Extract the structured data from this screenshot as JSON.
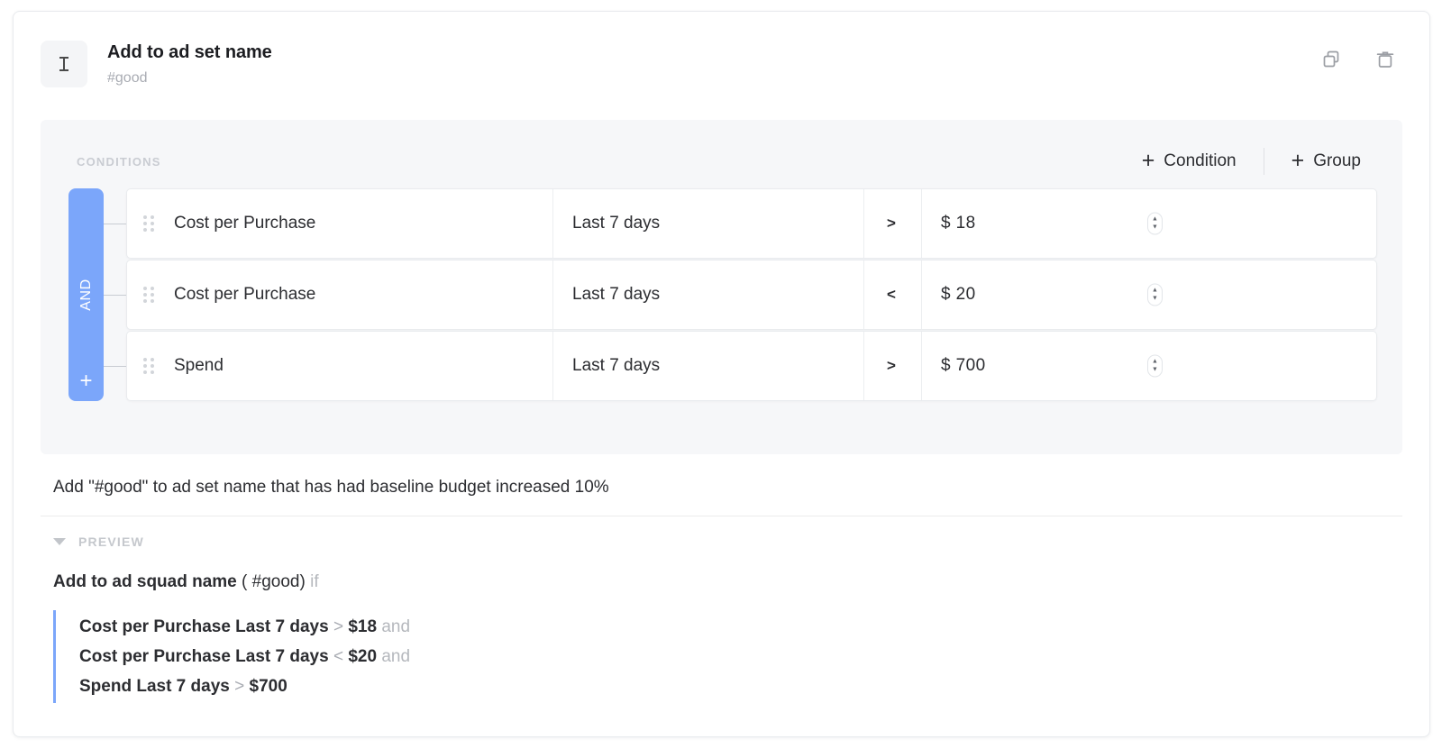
{
  "header": {
    "icon": "text-cursor-icon",
    "title": "Add to ad set name",
    "subtitle": "#good",
    "duplicate_icon": "copy-icon",
    "delete_icon": "trash-icon"
  },
  "conditions": {
    "label": "CONDITIONS",
    "add_condition_label": "Condition",
    "add_group_label": "Group",
    "plus_glyph": "+",
    "group_operator": "AND",
    "group_add_glyph": "+",
    "accent_color": "#7ba6fa",
    "panel_background": "#f6f7f9",
    "rows": [
      {
        "metric": "Cost per Purchase",
        "range": "Last 7 days",
        "operator": ">",
        "value": "$ 18"
      },
      {
        "metric": "Cost per Purchase",
        "range": "Last 7 days",
        "operator": "<",
        "value": "$ 20"
      },
      {
        "metric": "Spend",
        "range": "Last 7 days",
        "operator": ">",
        "value": "$ 700"
      }
    ]
  },
  "description": "Add \"#good\" to ad set name that has had baseline budget increased 10%",
  "preview": {
    "toggle_label": "PREVIEW",
    "caret_icon": "chevron-down-icon",
    "headline_action": "Add to ad squad name",
    "headline_tag": "( #good)",
    "headline_if": "if",
    "lines": [
      {
        "subject": "Cost per Purchase Last 7 days",
        "operator": ">",
        "value": "$18",
        "conjunction": "and"
      },
      {
        "subject": "Cost per Purchase Last 7 days",
        "operator": "<",
        "value": "$20",
        "conjunction": "and"
      },
      {
        "subject": "Spend Last 7 days",
        "operator": ">",
        "value": "$700",
        "conjunction": ""
      }
    ]
  }
}
